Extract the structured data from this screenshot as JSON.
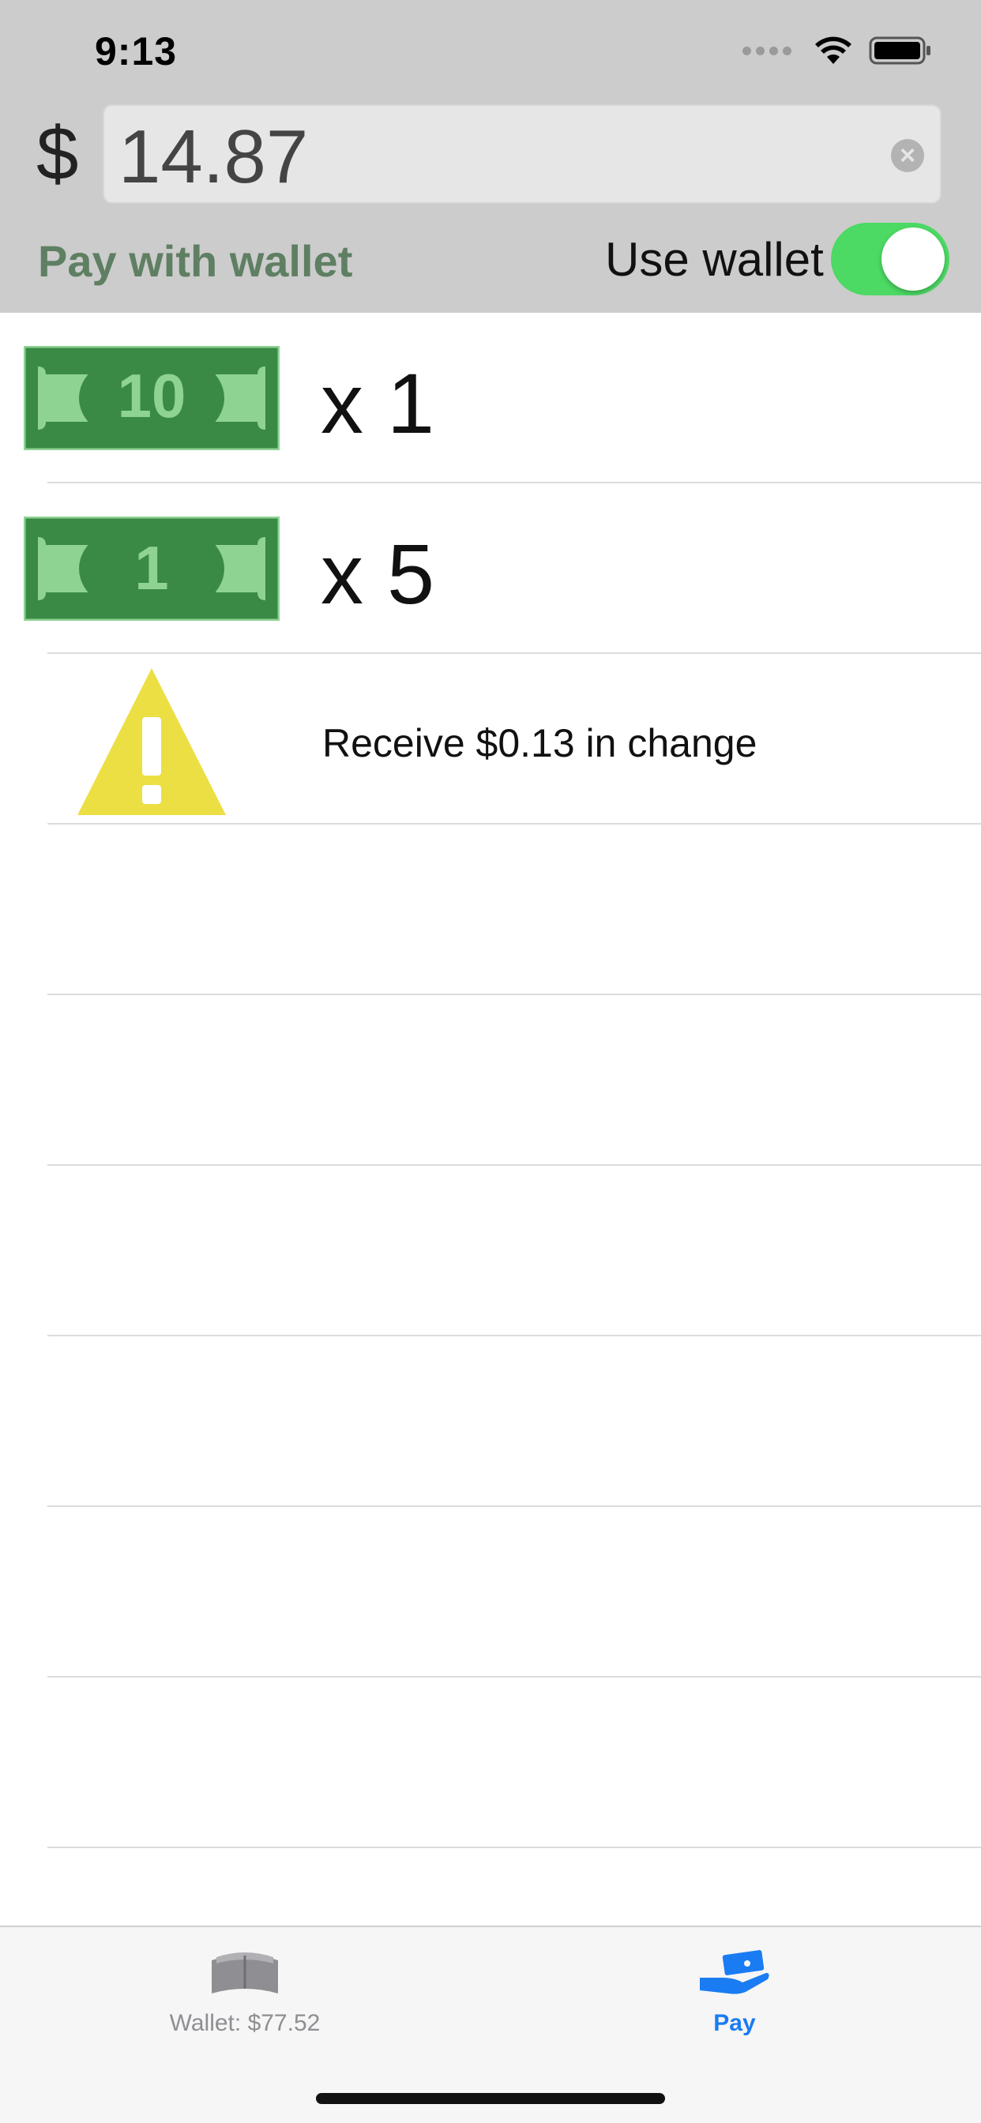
{
  "status_bar": {
    "time": "9:13"
  },
  "header": {
    "currency_symbol": "$",
    "amount": "14.87",
    "pay_with_wallet_label": "Pay with wallet",
    "use_wallet_label": "Use wallet",
    "use_wallet_on": true
  },
  "payment_rows": [
    {
      "bill": "10",
      "count": "x 1"
    },
    {
      "bill": "1",
      "count": "x 5"
    }
  ],
  "change_row": {
    "text": "Receive $0.13 in change",
    "icon": "warning-icon"
  },
  "tabbar": {
    "wallet_label": "Wallet: $77.52",
    "pay_label": "Pay",
    "active": "pay"
  },
  "colors": {
    "header_bg": "#cccccc",
    "bill_dark": "#3a8a45",
    "bill_light": "#8fd392",
    "toggle_on": "#4cd964",
    "warning": "#ecdf44",
    "tab_active": "#1a7cf2"
  }
}
